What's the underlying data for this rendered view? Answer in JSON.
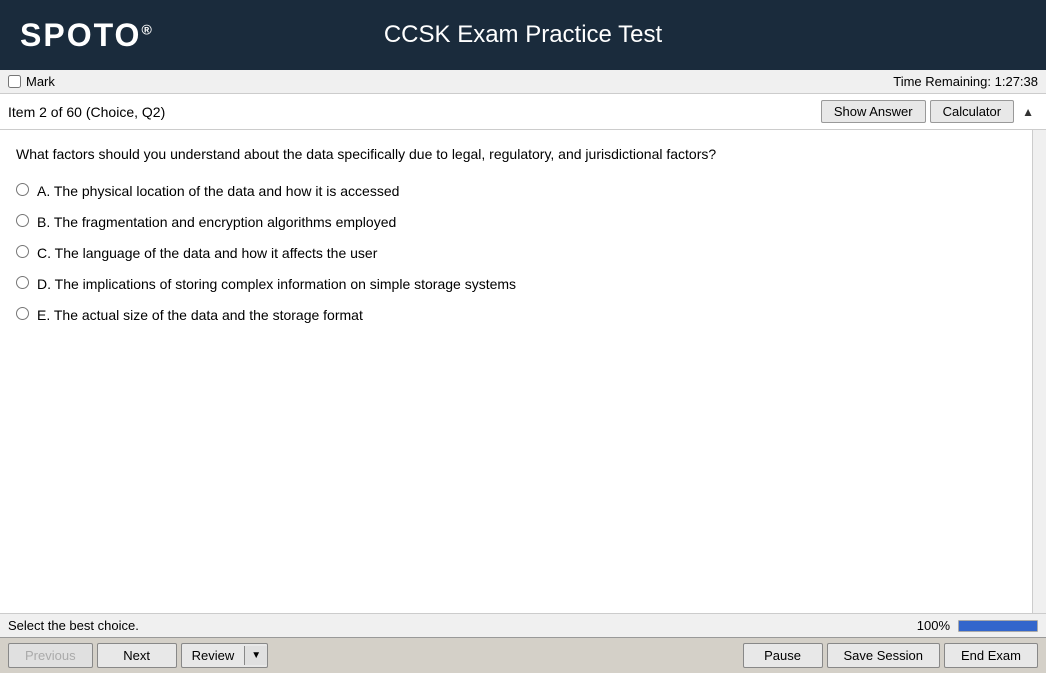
{
  "header": {
    "logo": "SPOTO",
    "logo_sup": "®",
    "title": "CCSK Exam Practice Test"
  },
  "mark_bar": {
    "mark_label": "Mark",
    "timer_label": "Time Remaining: 1:27:38"
  },
  "item_bar": {
    "item_text": "Item",
    "item_number": "2",
    "item_total": "60",
    "item_type": "Choice, Q2",
    "show_answer_label": "Show Answer",
    "calculator_label": "Calculator"
  },
  "question": {
    "text": "What factors should you understand about the data specifically due to legal, regulatory, and jurisdictional factors?",
    "options": [
      {
        "id": "A",
        "text": "The physical location of the data and how it is accessed"
      },
      {
        "id": "B",
        "text": "The fragmentation and encryption algorithms employed"
      },
      {
        "id": "C",
        "text": "The language of the data and how it affects the user"
      },
      {
        "id": "D",
        "text": "The implications of storing complex information on simple storage systems"
      },
      {
        "id": "E",
        "text": "The actual size of the data and the storage format"
      }
    ]
  },
  "status_bar": {
    "text": "Select the best choice.",
    "progress_percent": "100%"
  },
  "bottom_nav": {
    "previous_label": "Previous",
    "next_label": "Next",
    "review_label": "Review",
    "pause_label": "Pause",
    "save_session_label": "Save Session",
    "end_exam_label": "End Exam"
  }
}
